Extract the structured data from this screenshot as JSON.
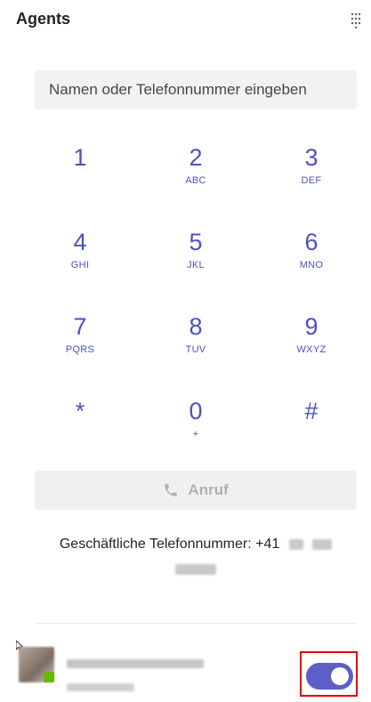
{
  "header": {
    "title": "Agents"
  },
  "search": {
    "placeholder": "Namen oder Telefonnummer eingeben"
  },
  "keypad": [
    {
      "digit": "1",
      "letters": ""
    },
    {
      "digit": "2",
      "letters": "ABC"
    },
    {
      "digit": "3",
      "letters": "DEF"
    },
    {
      "digit": "4",
      "letters": "GHI"
    },
    {
      "digit": "5",
      "letters": "JKL"
    },
    {
      "digit": "6",
      "letters": "MNO"
    },
    {
      "digit": "7",
      "letters": "PQRS"
    },
    {
      "digit": "8",
      "letters": "TUV"
    },
    {
      "digit": "9",
      "letters": "WXYZ"
    },
    {
      "digit": "*",
      "letters": ""
    },
    {
      "digit": "0",
      "letters": "+"
    },
    {
      "digit": "#",
      "letters": ""
    }
  ],
  "call": {
    "label": "Anruf"
  },
  "business_number": {
    "label": "Geschäftliche Telefonnummer: +41"
  },
  "presence": {
    "toggle_on": true
  },
  "colors": {
    "accent": "#5b5fc7",
    "highlight_frame": "#e00000",
    "status_available": "#6bb700"
  },
  "icons": {
    "menu": "dots-grid-icon",
    "call": "phone-icon"
  }
}
